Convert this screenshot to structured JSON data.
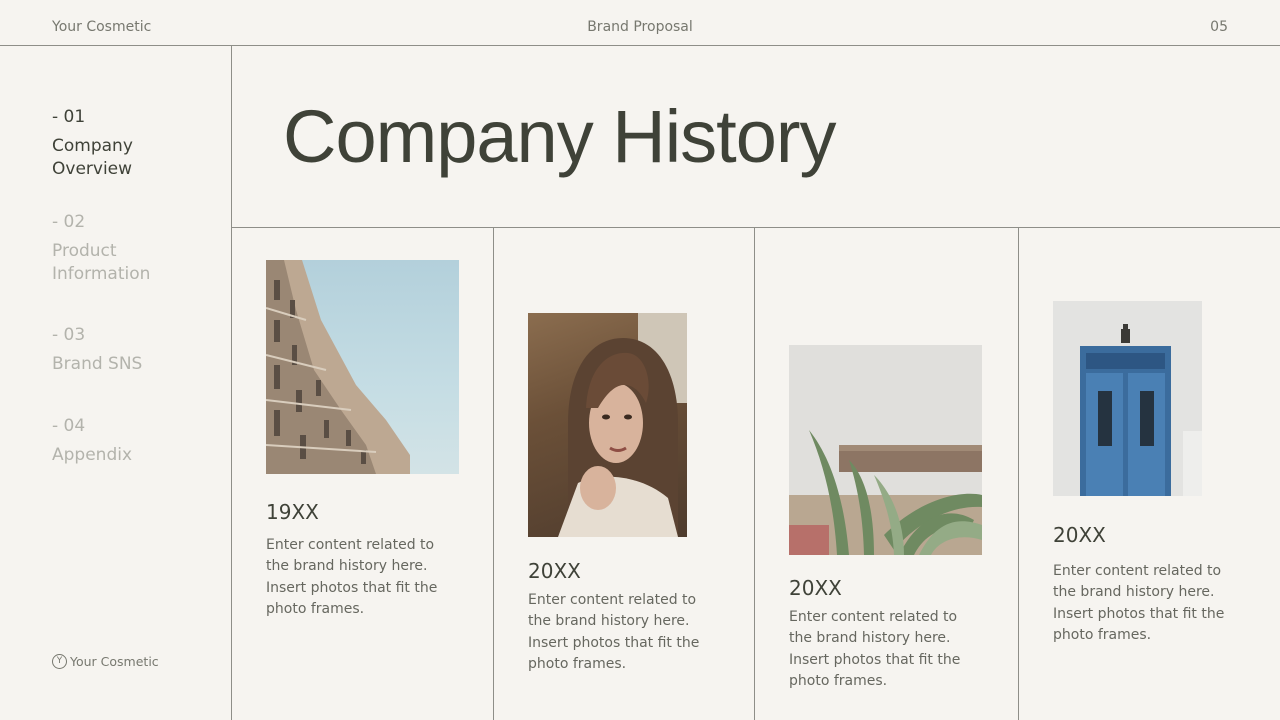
{
  "header": {
    "brand": "Your Cosmetic",
    "center_title": "Brand Proposal",
    "page_number": "05"
  },
  "sidebar": {
    "items": [
      {
        "number": "- 01",
        "label": "Company Overview",
        "active": true
      },
      {
        "number": "- 02",
        "label": "Product Information",
        "active": false
      },
      {
        "number": "- 03",
        "label": "Brand SNS",
        "active": false
      },
      {
        "number": "- 04",
        "label": "Appendix",
        "active": false
      }
    ],
    "footer_logo_letter": "Y",
    "footer_brand": "Your Cosmetic"
  },
  "main": {
    "title": "Company History",
    "timeline": [
      {
        "year": "19XX",
        "text": "Enter content related to the brand history here. Insert photos that fit the photo frames.",
        "photo": "building-sky-photo"
      },
      {
        "year": "20XX",
        "text": "Enter content related to the brand history here. Insert photos that fit the photo frames.",
        "photo": "woman-portrait-photo"
      },
      {
        "year": "20XX",
        "text": "Enter content related to the brand history here. Insert photos that fit the photo frames.",
        "photo": "plant-wall-photo"
      },
      {
        "year": "20XX",
        "text": "Enter content related to the brand history here. Insert photos that fit the photo frames.",
        "photo": "blue-door-photo"
      }
    ]
  },
  "colors": {
    "background": "#f6f4f0",
    "text_dark": "#3f4238",
    "text_muted": "#b3b3ac",
    "divider": "#8e8e88"
  }
}
